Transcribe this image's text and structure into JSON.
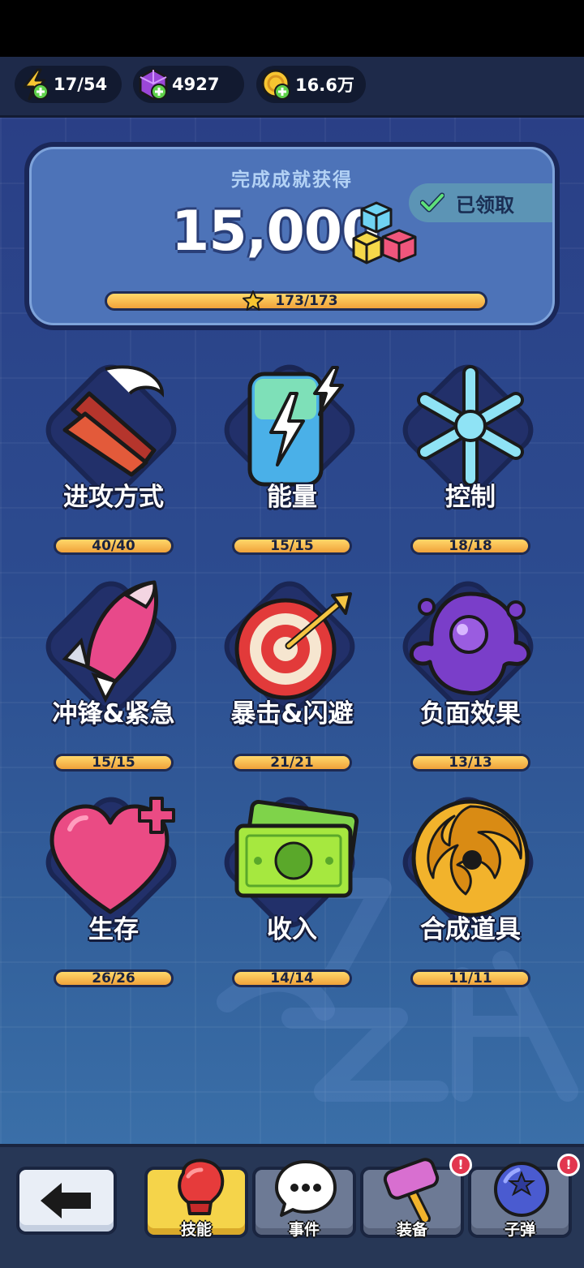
{
  "resources": {
    "energy": "17/54",
    "gems": "4927",
    "coins": "16.6万"
  },
  "achievement": {
    "title": "完成成就获得",
    "claimed_label": "已领取",
    "reward": "15,000",
    "progress_text": "173/173",
    "progress": 1.0
  },
  "categories": [
    {
      "label": "进攻方式",
      "progress": "40/40"
    },
    {
      "label": "能量",
      "progress": "15/15"
    },
    {
      "label": "控制",
      "progress": "18/18"
    },
    {
      "label": "冲锋&紧急",
      "progress": "15/15"
    },
    {
      "label": "暴击&闪避",
      "progress": "21/21"
    },
    {
      "label": "负面效果",
      "progress": "13/13"
    },
    {
      "label": "生存",
      "progress": "26/26"
    },
    {
      "label": "收入",
      "progress": "14/14"
    },
    {
      "label": "合成道具",
      "progress": "11/11"
    }
  ],
  "bottom_nav": {
    "tabs": [
      {
        "label": "技能",
        "icon": "boxing-glove-icon",
        "active": true
      },
      {
        "label": "事件",
        "icon": "chat-bubble-icon",
        "alert": false
      },
      {
        "label": "装备",
        "icon": "hammer-icon",
        "alert": true
      },
      {
        "label": "子弹",
        "icon": "blueberry-icon",
        "alert": true
      }
    ],
    "alert_mark": "!"
  },
  "colors": {
    "accent_gold": "#f0a23a",
    "panel_blue": "#4d73b8",
    "active_tab": "#f5d44a"
  }
}
